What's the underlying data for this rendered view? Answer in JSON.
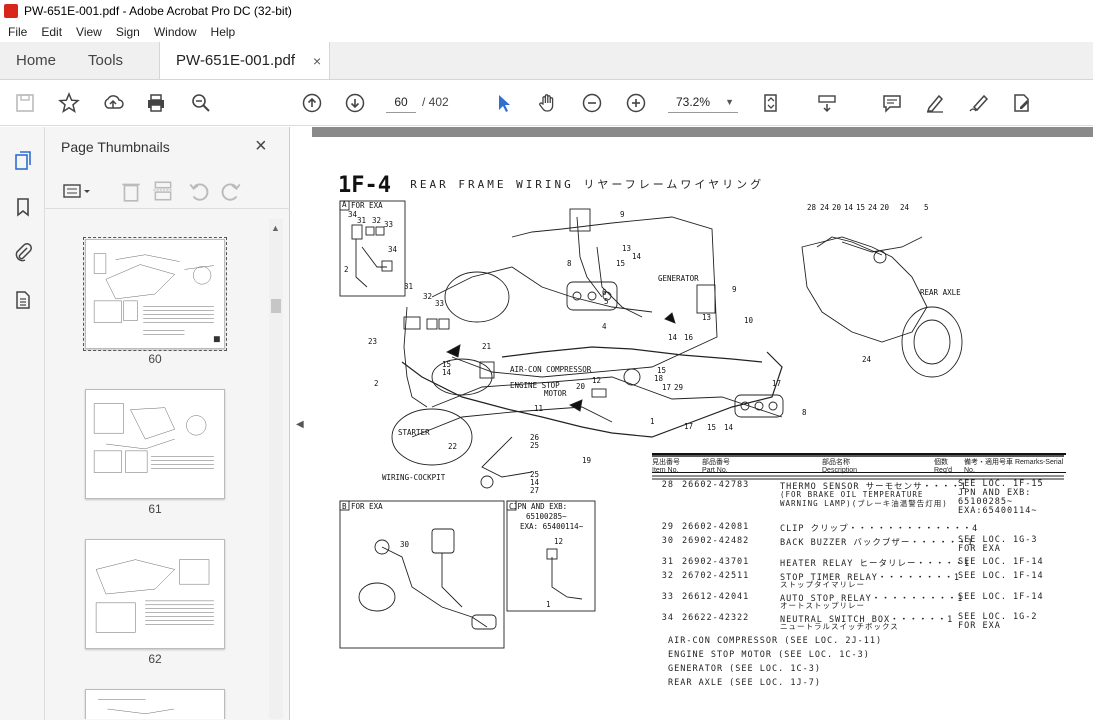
{
  "window": {
    "title": "PW-651E-001.pdf - Adobe Acrobat Pro DC (32-bit)"
  },
  "menu": [
    "File",
    "Edit",
    "View",
    "Sign",
    "Window",
    "Help"
  ],
  "tabs": {
    "home": "Home",
    "tools": "Tools",
    "document": "PW-651E-001.pdf",
    "close": "×"
  },
  "toolbar": {
    "page_current": "60",
    "page_total": "/ 402",
    "zoom": "73.2%"
  },
  "panel": {
    "title": "Page Thumbnails",
    "close": "×"
  },
  "thumbnails": [
    {
      "label": "60"
    },
    {
      "label": "61"
    },
    {
      "label": "62"
    }
  ],
  "document": {
    "section": "1F-4",
    "heading": "REAR FRAME WIRING  リヤーフレームワイヤリング",
    "inset_a": "FOR EXA",
    "inset_b": "FOR EXA",
    "inset_c": "JPN AND EXB: 65100285~ EXA: 65400114~",
    "labels": {
      "generator": "GENERATOR",
      "rear_axle": "REAR AXLE",
      "aircon": "AIR-CON COMPRESSOR",
      "engine_stop": "ENGINE STOP",
      "motor": "MOTOR",
      "starter": "STARTER",
      "cockpit": "WIRING-COCKPIT"
    },
    "table_header": {
      "item": "見出番号 Item No.",
      "part": "部品番号 Part No.",
      "desc": "部品名称 Description",
      "req": "個数 Req'd",
      "remarks": "備考・適用号車 Remarks-Serial No."
    },
    "parts": [
      {
        "item": "28",
        "part": "26602-42783",
        "desc": "THERMO SENSOR サーモセンサ・・・・1",
        "sub": "(FOR BRAKE OIL TEMPERATURE WARNING LAMP)(ブレーキ油温警告灯用)",
        "remarks": "SEE LOC. 1F-15 JPN AND EXB: 65100285~ EXA:65400114~"
      },
      {
        "item": "29",
        "part": "26602-42081",
        "desc": "CLIP クリップ・・・・・・・・・・・・・4",
        "sub": "",
        "remarks": ""
      },
      {
        "item": "30",
        "part": "26902-42482",
        "desc": "BACK BUZZER バックブザー・・・・・・1",
        "sub": "",
        "remarks": "SEE LOC. 1G-3 FOR EXA"
      },
      {
        "item": "31",
        "part": "26902-43701",
        "desc": "HEATER RELAY ヒータリレー・・・・・1",
        "sub": "",
        "remarks": "SEE LOC. 1F-14"
      },
      {
        "item": "32",
        "part": "26702-42511",
        "desc": "STOP TIMER RELAY・・・・・・・・1",
        "sub": "ストップタイマリレー",
        "remarks": "SEE LOC. 1F-14"
      },
      {
        "item": "33",
        "part": "26612-42041",
        "desc": "AUTO STOP RELAY・・・・・・・・・1",
        "sub": "オートストップリレー",
        "remarks": "SEE LOC. 1F-14"
      },
      {
        "item": "34",
        "part": "26622-42322",
        "desc": "NEUTRAL SWITCH BOX・・・・・・1",
        "sub": "ニュートラルスイッチボックス",
        "remarks": "SEE LOC. 1G-2 FOR EXA"
      }
    ],
    "notes": [
      "AIR-CON COMPRESSOR (SEE LOC. 2J-11)",
      "ENGINE STOP MOTOR (SEE LOC. 1C-3)",
      "GENERATOR (SEE LOC. 1C-3)",
      "REAR AXLE (SEE LOC. 1J-7)"
    ]
  }
}
